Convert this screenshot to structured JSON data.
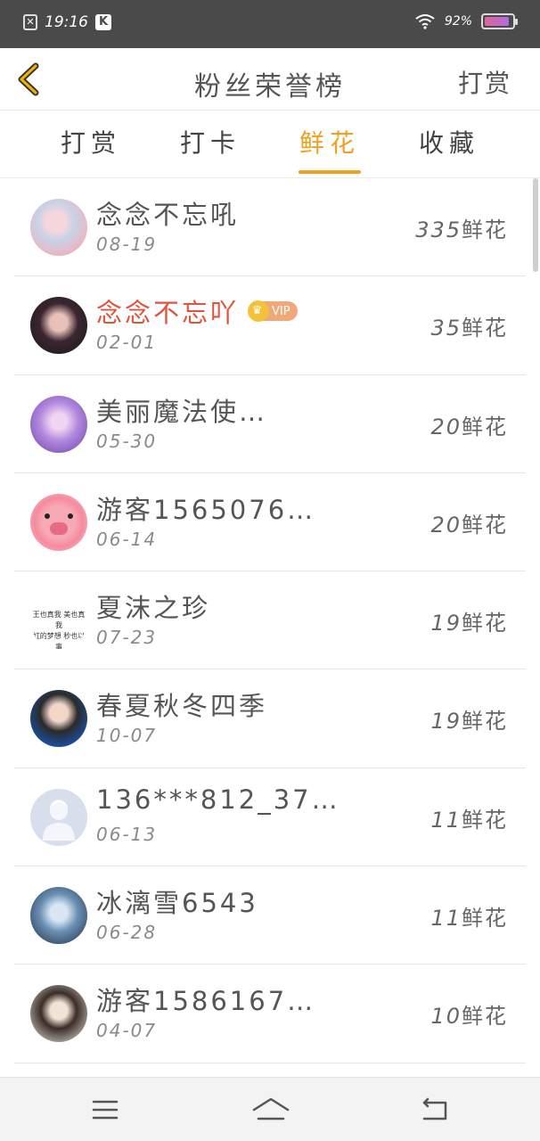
{
  "status_bar": {
    "time": "19:16",
    "k_label": "K",
    "battery": "92%",
    "battery_level": 0.92
  },
  "header": {
    "title": "粉丝荣誉榜",
    "action_label": "打赏"
  },
  "tabs": [
    {
      "label": "打赏",
      "active": false
    },
    {
      "label": "打卡",
      "active": false
    },
    {
      "label": "鲜花",
      "active": true
    },
    {
      "label": "收藏",
      "active": false
    }
  ],
  "colors": {
    "accent": "#f0a020",
    "vip_name": "#e0533c",
    "status_bar_bg": "#4a4a4a"
  },
  "list": [
    {
      "name": "念念不忘吼",
      "date": "08-19",
      "count": "335",
      "unit": "鲜花",
      "vip": false,
      "avatar": "avatar-anime-girl"
    },
    {
      "name": "念念不忘吖",
      "date": "02-01",
      "count": "35",
      "unit": "鲜花",
      "vip": true,
      "vip_label": "VIP",
      "avatar": "avatar-girl-photo"
    },
    {
      "name": "美丽魔法使…",
      "date": "05-30",
      "count": "20",
      "unit": "鲜花",
      "vip": false,
      "avatar": "avatar-magic-girl"
    },
    {
      "name": "游客1565076…",
      "date": "06-14",
      "count": "20",
      "unit": "鲜花",
      "vip": false,
      "avatar": "avatar-pig"
    },
    {
      "name": "夏沫之珍",
      "date": "07-23",
      "count": "19",
      "unit": "鲜花",
      "vip": false,
      "avatar": "avatar-text-art",
      "avatar_text": [
        "王也真我 美也真我",
        "虹的梦想 秒也以事"
      ]
    },
    {
      "name": "春夏秋冬四季",
      "date": "10-07",
      "count": "19",
      "unit": "鲜花",
      "vip": false,
      "avatar": "avatar-girl-blue"
    },
    {
      "name": "136***812_37…",
      "date": "06-13",
      "count": "11",
      "unit": "鲜花",
      "vip": false,
      "avatar": "avatar-default"
    },
    {
      "name": "冰漓雪6543",
      "date": "06-28",
      "count": "11",
      "unit": "鲜花",
      "vip": false,
      "avatar": "avatar-ice-girl"
    },
    {
      "name": "游客1586167…",
      "date": "04-07",
      "count": "10",
      "unit": "鲜花",
      "vip": false,
      "avatar": "avatar-girl-light"
    }
  ],
  "nav": {
    "menu_icon": "menu-icon",
    "home_icon": "home-icon",
    "back_icon": "back-icon"
  }
}
